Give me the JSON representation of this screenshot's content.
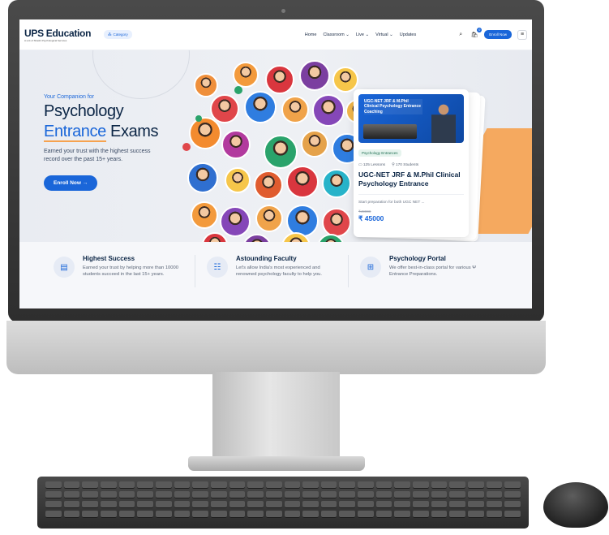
{
  "navbar": {
    "logo_title": "UPS Education",
    "logo_subtitle": "A unit of Shashi Psychological Services",
    "category_label": "Category",
    "links": [
      "Home",
      "Classroom ⌄",
      "Live ⌄",
      "Virtual ⌄",
      "Updates"
    ],
    "cart_count": "0",
    "enroll_label": "Enroll Now"
  },
  "hero": {
    "eyebrow": "Your Companion for",
    "title_line1": "Psychology",
    "title_highlight": "Entrance",
    "title_rest": "Exams",
    "description": "Earned your trust with the highest success record over the past 15+ years.",
    "cta_label": "Enroll Now →"
  },
  "course_card": {
    "thumb_title": "UGC-NET JRF & M.Phil Clinical Psychology Entrance Coaching",
    "tag": "Psychology Entrances",
    "lessons": "125 Lessons",
    "students": "170 Students",
    "title": "UGC-NET JRF & M.Phil Clinical Psychology Entrance",
    "description": "Start preparation for both UGC NET ...",
    "old_price": "₹49000",
    "price": "₹ 45000"
  },
  "features": [
    {
      "title": "Highest Success",
      "description": "Earned your trust by helping more than 10000 students succeed in the last 15+ years.",
      "icon": "certificate-icon"
    },
    {
      "title": "Astounding Faculty",
      "description": "Let's allow India's most experienced and renowned psychology faculty to help you.",
      "icon": "faculty-icon"
    },
    {
      "title": "Psychology Portal",
      "description": "We offer best-in-class portal for various Ψ Entrance Preparations.",
      "icon": "portal-icon"
    }
  ],
  "colors": {
    "brand": "#1a66d9",
    "navy": "#0b2545",
    "accent": "#f6a24f"
  }
}
